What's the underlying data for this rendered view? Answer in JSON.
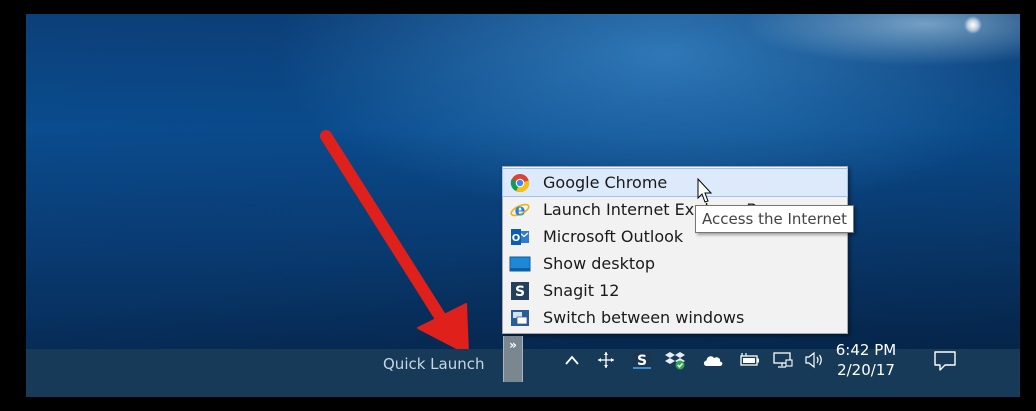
{
  "quick_launch": {
    "label": "Quick Launch",
    "toggle_glyph": "»",
    "items": [
      {
        "label": "Google Chrome",
        "icon": "chrome-icon"
      },
      {
        "label": "Launch Internet Explorer Browser",
        "icon": "internet-explorer-icon"
      },
      {
        "label": "Microsoft Outlook",
        "icon": "outlook-icon"
      },
      {
        "label": "Show desktop",
        "icon": "show-desktop-icon"
      },
      {
        "label": "Snagit 12",
        "icon": "snagit-icon"
      },
      {
        "label": "Switch between windows",
        "icon": "switch-windows-icon"
      }
    ],
    "hovered_index": 0
  },
  "tooltip": {
    "text": "Access the Internet"
  },
  "tray": {
    "icons": [
      "chevron-up-icon",
      "move-icon",
      "snagit-icon",
      "dropbox-icon",
      "onedrive-icon",
      "battery-icon",
      "network-icon",
      "volume-icon"
    ]
  },
  "clock": {
    "time": "6:42 PM",
    "date": "2/20/17"
  },
  "colors": {
    "taskbar": "#163a57",
    "arrow": "#e0201b",
    "menu_bg": "#f2f2f2",
    "hover": "#dceafb"
  }
}
